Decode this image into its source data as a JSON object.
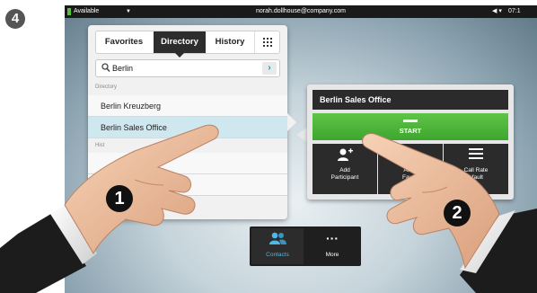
{
  "step_number": "4",
  "status_bar": {
    "availability": "Available",
    "user": "norah.dollhouse@company.com",
    "time": "07:1"
  },
  "contacts_panel": {
    "tabs": [
      {
        "label": "Favorites"
      },
      {
        "label": "Directory"
      },
      {
        "label": "History"
      }
    ],
    "grid_icon": "grid-icon",
    "search": {
      "value": "Berlin",
      "placeholder": "",
      "go_icon": "›"
    },
    "directory_section": "Directory",
    "directory_results": [
      {
        "name": "Berlin Kreuzberg"
      },
      {
        "name": "Berlin Sales Office"
      }
    ],
    "history_section": "Hist",
    "history_partial": "y"
  },
  "detail_panel": {
    "title": "Berlin Sales Office",
    "start_label": "START",
    "actions": [
      {
        "icon": "add-participant-icon",
        "line1": "Add",
        "line2": "Participant"
      },
      {
        "icon": "add-favorite-icon",
        "line1": "Add t",
        "line2": "Favori"
      },
      {
        "icon": "call-rate-icon",
        "line1": "Call Rate",
        "line2": "efault"
      }
    ]
  },
  "dock": {
    "contacts_label": "Contacts",
    "more_label": "More",
    "more_icon": "···"
  },
  "callouts": [
    "1",
    "2"
  ],
  "colors": {
    "start_green": "#4cb43a",
    "selected_row": "#cfe7ee",
    "dark_panel": "#2b2b2b",
    "contacts_blue": "#4cb8e8"
  }
}
